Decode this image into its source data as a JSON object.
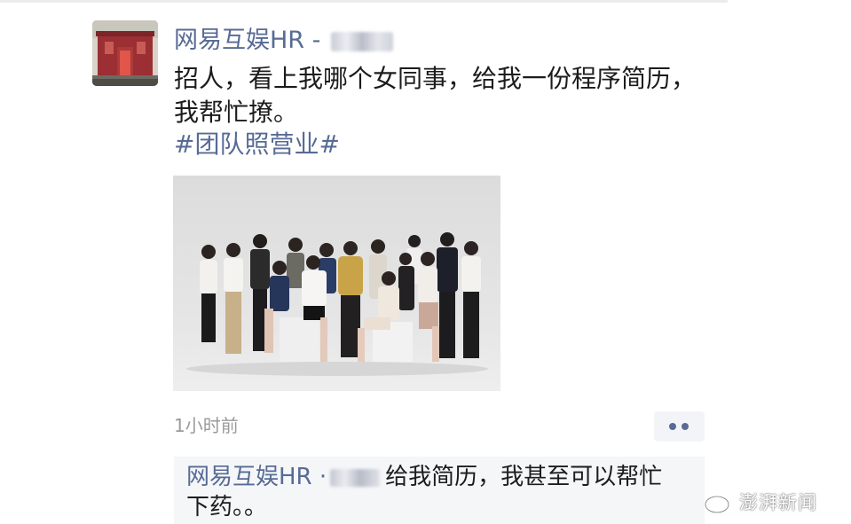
{
  "post": {
    "author": "网易互娱HR -",
    "text": "招人，看上我哪个女同事，给我一份程序简历，我帮忙撩。",
    "hashtag": "#团队照营业#",
    "timestamp": "1小时前"
  },
  "comment": {
    "author": "网易互娱HR",
    "separator": "·",
    "text": "给我简历，我甚至可以帮忙下药。。"
  },
  "watermark": {
    "text": "澎湃新闻"
  },
  "colors": {
    "link": "#576b95",
    "body_text": "#1c1c1c",
    "muted": "#9a9a9a"
  },
  "icons": {
    "more": "two-dots-icon",
    "watermark": "weibo-icon"
  }
}
